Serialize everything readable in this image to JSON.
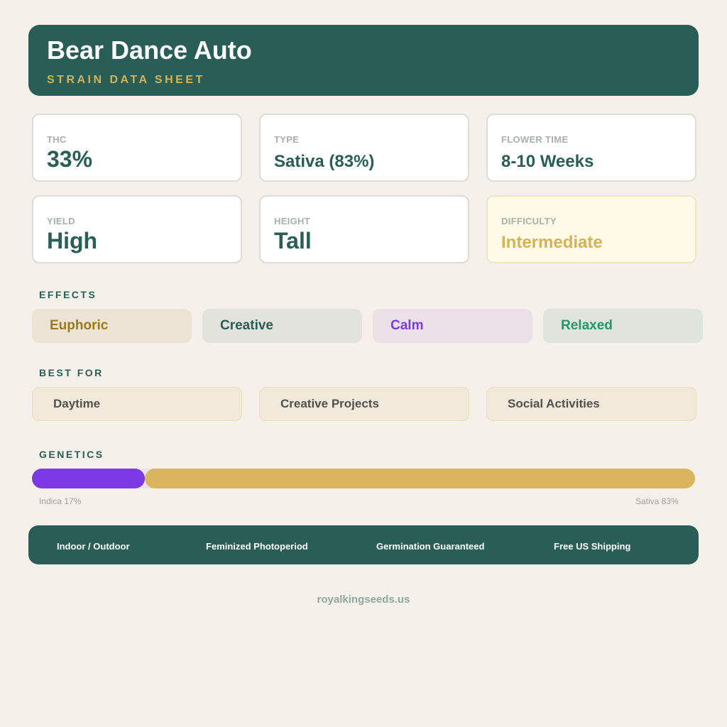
{
  "header": {
    "title": "Bear Dance Auto",
    "subtitle": "STRAIN DATA SHEET"
  },
  "stats": [
    {
      "label": "THC",
      "value": "33%"
    },
    {
      "label": "TYPE",
      "value": "Sativa (83%)"
    },
    {
      "label": "FLOWER TIME",
      "value": "8-10 Weeks"
    },
    {
      "label": "YIELD",
      "value": "High"
    },
    {
      "label": "HEIGHT",
      "value": "Tall"
    },
    {
      "label": "DIFFICULTY",
      "value": "Intermediate"
    }
  ],
  "effects": {
    "title": "EFFECTS",
    "items": [
      {
        "label": "Euphoric",
        "bg": "#ede3d4",
        "color": "#9a7a1c"
      },
      {
        "label": "Creative",
        "bg": "#e3e3dd",
        "color": "#285e55"
      },
      {
        "label": "Calm",
        "bg": "#ebe0e8",
        "color": "#7b3ae6"
      },
      {
        "label": "Relaxed",
        "bg": "#dfe5dd",
        "color": "#1e9a6c"
      }
    ]
  },
  "best_for": {
    "title": "BEST FOR",
    "items": [
      "Daytime",
      "Creative Projects",
      "Social Activities"
    ]
  },
  "genetics": {
    "title": "GENETICS",
    "indica_label": "Indica 17%",
    "sativa_label": "Sativa 83%",
    "indica_percent": 17,
    "sativa_percent": 83,
    "indica_color": "#7b3ae6",
    "sativa_color": "#d9b55e"
  },
  "features": [
    "Indoor / Outdoor",
    "Feminized Photoperiod",
    "Germination Guaranteed",
    "Free US Shipping"
  ],
  "website": "royalkingseeds.us",
  "colors": {
    "primary": "#285e55",
    "accent": "#d4b25a",
    "background": "#f5f0ea"
  }
}
